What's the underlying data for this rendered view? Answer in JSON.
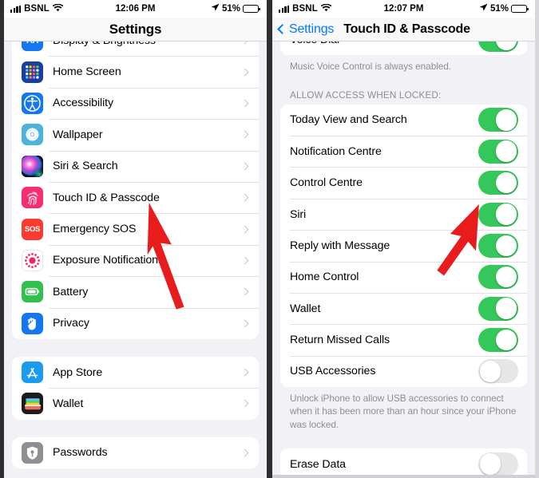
{
  "left_phone": {
    "status_bar": {
      "carrier": "BSNL",
      "time": "12:06 PM",
      "battery_percent": "51%",
      "signal_icon": "cellular-bars-icon",
      "wifi_icon": "wifi-icon",
      "location_icon": "location-arrow-icon",
      "battery_icon": "battery-icon"
    },
    "nav": {
      "title": "Settings"
    },
    "groups": [
      {
        "id": "group-display",
        "rows": [
          {
            "label": "Display & Brightness",
            "icon": "display-brightness-icon",
            "accessory": "chevron-right-icon"
          },
          {
            "label": "Home Screen",
            "icon": "home-screen-icon",
            "accessory": "chevron-right-icon"
          },
          {
            "label": "Accessibility",
            "icon": "accessibility-icon",
            "accessory": "chevron-right-icon"
          },
          {
            "label": "Wallpaper",
            "icon": "wallpaper-icon",
            "accessory": "chevron-right-icon"
          },
          {
            "label": "Siri & Search",
            "icon": "siri-search-icon",
            "accessory": "chevron-right-icon"
          },
          {
            "label": "Touch ID & Passcode",
            "icon": "touch-id-icon",
            "accessory": "chevron-right-icon"
          },
          {
            "label": "Emergency SOS",
            "icon": "emergency-sos-icon",
            "accessory": "chevron-right-icon"
          },
          {
            "label": "Exposure Notifications",
            "icon": "exposure-notifications-icon",
            "accessory": "chevron-right-icon"
          },
          {
            "label": "Battery",
            "icon": "battery-settings-icon",
            "accessory": "chevron-right-icon"
          },
          {
            "label": "Privacy",
            "icon": "privacy-icon",
            "accessory": "chevron-right-icon"
          }
        ]
      },
      {
        "id": "group-store",
        "rows": [
          {
            "label": "App Store",
            "icon": "app-store-icon",
            "accessory": "chevron-right-icon"
          },
          {
            "label": "Wallet",
            "icon": "wallet-icon",
            "accessory": "chevron-right-icon"
          }
        ]
      },
      {
        "id": "group-passwords",
        "rows": [
          {
            "label": "Passwords",
            "icon": "passwords-icon",
            "accessory": "chevron-right-icon"
          }
        ]
      }
    ]
  },
  "right_phone": {
    "status_bar": {
      "carrier": "BSNL",
      "time": "12:07 PM",
      "battery_percent": "51%",
      "signal_icon": "cellular-bars-icon",
      "wifi_icon": "wifi-icon",
      "location_icon": "location-arrow-icon",
      "battery_icon": "battery-icon"
    },
    "nav": {
      "back_label": "Settings",
      "back_icon": "chevron-left-icon",
      "title": "Touch ID & Passcode"
    },
    "voice_group": {
      "rows": [
        {
          "label": "Voice Dial",
          "toggle": "on"
        }
      ],
      "footnote": "Music Voice Control is always enabled."
    },
    "allow_access_section": {
      "header": "ALLOW ACCESS WHEN LOCKED:",
      "rows": [
        {
          "label": "Today View and Search",
          "toggle": "on"
        },
        {
          "label": "Notification Centre",
          "toggle": "on"
        },
        {
          "label": "Control Centre",
          "toggle": "on"
        },
        {
          "label": "Siri",
          "toggle": "on"
        },
        {
          "label": "Reply with Message",
          "toggle": "on"
        },
        {
          "label": "Home Control",
          "toggle": "on"
        },
        {
          "label": "Wallet",
          "toggle": "on"
        },
        {
          "label": "Return Missed Calls",
          "toggle": "on"
        },
        {
          "label": "USB Accessories",
          "toggle": "off"
        }
      ],
      "footnote": "Unlock iPhone to allow USB accessories to connect when it has been more than an hour since your iPhone was locked."
    },
    "erase_group": {
      "rows": [
        {
          "label": "Erase Data",
          "toggle": "off"
        }
      ]
    }
  },
  "annotations": {
    "left_arrow": {
      "name": "red-arrow-pointing-to-touch-id",
      "color": "#e81c1c",
      "target": "Touch ID & Passcode"
    },
    "right_arrow": {
      "name": "red-arrow-pointing-to-control-centre-toggle",
      "color": "#e81c1c",
      "target": "Control Centre"
    }
  },
  "colors": {
    "toggle_on": "#34c759",
    "toggle_off": "#e6e6e9",
    "accent_blue": "#007aff",
    "background": "#f2f1f6",
    "arrow_red": "#e81c1c"
  }
}
